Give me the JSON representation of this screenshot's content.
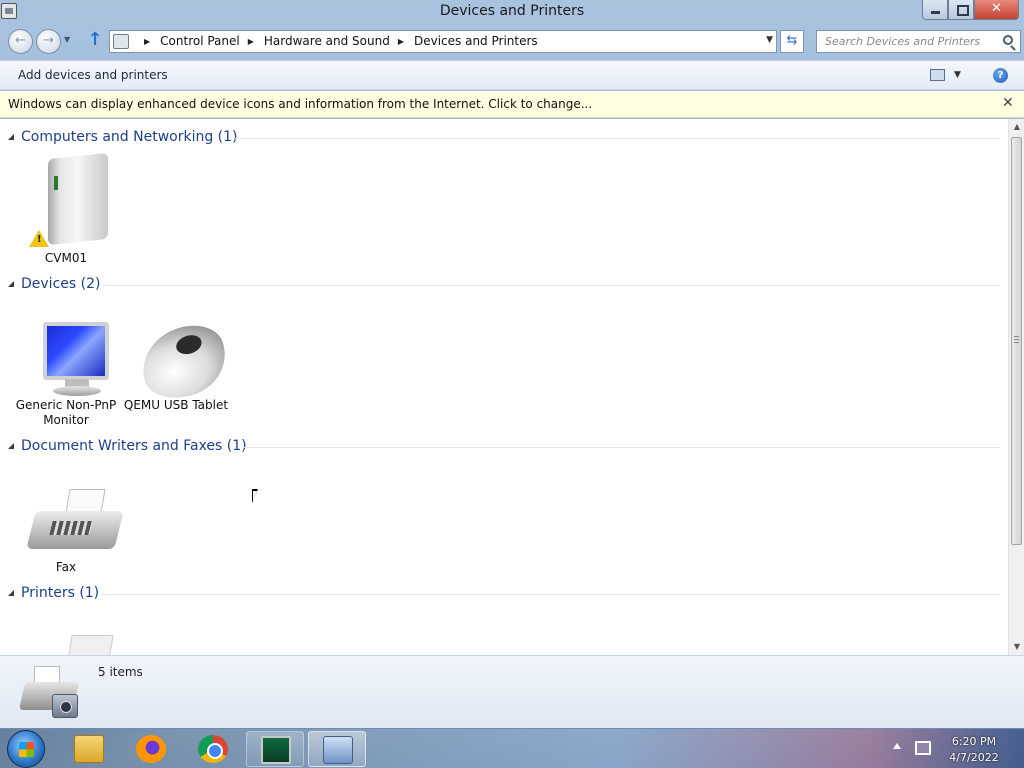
{
  "window": {
    "title": "Devices and Printers",
    "close_glyph": "✕"
  },
  "nav": {
    "back_glyph": "←",
    "forward_glyph": "→",
    "up_glyph": "↑",
    "breadcrumbs": [
      "Control Panel",
      "Hardware and Sound",
      "Devices and Printers"
    ],
    "refresh_glyph": "⇆",
    "search_placeholder": "Search Devices and Printers"
  },
  "commandbar": {
    "add_label": "Add devices and printers",
    "help_glyph": "?"
  },
  "infobar": {
    "text": "Windows can display enhanced device icons and information from the Internet. Click to change...",
    "close_glyph": "✕"
  },
  "groups": [
    {
      "title": "Computers and Networking (1)",
      "devices": [
        {
          "label": "CVM01",
          "icon": "computer-icon",
          "warning": true
        }
      ]
    },
    {
      "title": "Devices (2)",
      "devices": [
        {
          "label": "Generic Non-PnP Monitor",
          "icon": "monitor-icon"
        },
        {
          "label": "QEMU USB Tablet",
          "icon": "mouse-icon"
        }
      ]
    },
    {
      "title": "Document Writers and Faxes (1)",
      "devices": [
        {
          "label": "Fax",
          "icon": "fax-icon"
        }
      ]
    },
    {
      "title": "Printers (1)",
      "devices": [
        {
          "label": "",
          "icon": "printer-icon"
        }
      ]
    }
  ],
  "details": {
    "count": "5 items",
    "icon": "printer-camera-icon"
  },
  "taskbar": {
    "items": [
      {
        "name": "file-explorer",
        "icon": "folder-icon"
      },
      {
        "name": "firefox",
        "icon": "firefox-icon"
      },
      {
        "name": "chrome",
        "icon": "chrome-icon"
      },
      {
        "name": "resource-monitor",
        "icon": "monitor-app-icon"
      },
      {
        "name": "devices-and-printers",
        "icon": "devices-app-icon"
      }
    ],
    "clock_time": "6:20 PM",
    "clock_date": "4/7/2022"
  }
}
